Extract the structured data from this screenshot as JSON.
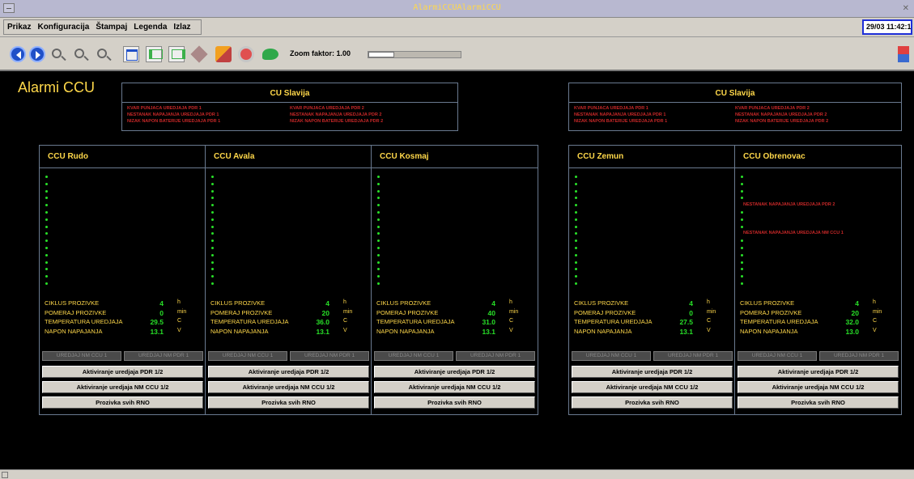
{
  "window": {
    "title": "AlarmiCCUAlarmiCCU"
  },
  "menu": [
    "Prikaz",
    "Konfiguracija",
    "Štampaj",
    "Legenda",
    "Izlaz"
  ],
  "clock": "29/03 11:42:1",
  "toolbar": {
    "zoom_label": "Zoom faktor: 1.00",
    "zoom_fraction": 0.28
  },
  "page_title": "Alarmi CCU",
  "cu_panels": [
    {
      "title": "CU Slavija",
      "alarms": [
        "KVAR PUNJACA UREDJAJA PDR 1",
        "KVAR PUNJACA UREDJAJA PDR 2",
        "NESTANAK NAPAJANJA UREDJAJA PDR 1",
        "NESTANAK NAPAJANJA UREDJAJA PDR 2",
        "NIZAK NAPON BATERIJE UREDJAJA PDR 1",
        "NIZAK NAPON BATERIJE UREDJAJA PDR 2"
      ]
    },
    {
      "title": "CU Slavija",
      "alarms": [
        "KVAR PUNJACA UREDJAJA PDR 1",
        "KVAR PUNJACA UREDJAJA PDR 2",
        "NESTANAK NAPAJANJA UREDJAJA PDR 1",
        "NESTANAK NAPAJANJA UREDJAJA PDR 2",
        "NIZAK NAPON BATERIJE UREDJAJA PDR 1",
        "NIZAK NAPON BATERIJE UREDJAJA PDR 2"
      ]
    }
  ],
  "labels": {
    "ciklus": "CIKLUS PROZIVKE",
    "pomeraj": "POMERAJ PROZIVKE",
    "temperatura": "TEMPERATURA UREDJAJA",
    "napon": "NAPON NAPAJANJA",
    "unit_h": "h",
    "unit_min": "min",
    "unit_c": "C",
    "unit_v": "V",
    "status_ccu": "UREDJAJ NM CCU 1",
    "status_pdr": "UREDJAJ NM PDR 1",
    "btn_pdr": "Aktiviranje uredjaja PDR 1/2",
    "btn_nm": "Aktiviranje uredjaja NM CCU 1/2",
    "btn_rno": "Prozivka svih RNO"
  },
  "ccus": [
    {
      "name": "CCU Rudo",
      "ciklus": "4",
      "pomeraj": "0",
      "temperatura": "29.5",
      "napon": "13.1",
      "dot_alarms": []
    },
    {
      "name": "CCU Avala",
      "ciklus": "4",
      "pomeraj": "20",
      "temperatura": "36.0",
      "napon": "13.1",
      "dot_alarms": []
    },
    {
      "name": "CCU Kosmaj",
      "ciklus": "4",
      "pomeraj": "40",
      "temperatura": "31.0",
      "napon": "13.1",
      "dot_alarms": []
    },
    {
      "name": "CCU Zemun",
      "ciklus": "4",
      "pomeraj": "0",
      "temperatura": "27.5",
      "napon": "13.1",
      "dot_alarms": []
    },
    {
      "name": "CCU Obrenovac",
      "ciklus": "4",
      "pomeraj": "20",
      "temperatura": "32.0",
      "napon": "13.0",
      "dot_alarms": [
        {
          "index": 4,
          "text": "NESTANAK NAPAJANJA UREDJAJA PDR 2"
        },
        {
          "index": 8,
          "text": "NESTANAK NAPAJANJA UREDJAJA NM CCU 1"
        }
      ]
    }
  ],
  "colors": {
    "value": "#28e028",
    "label": "#ffd84a",
    "alarm": "#c82828",
    "dot": "#28e028"
  }
}
